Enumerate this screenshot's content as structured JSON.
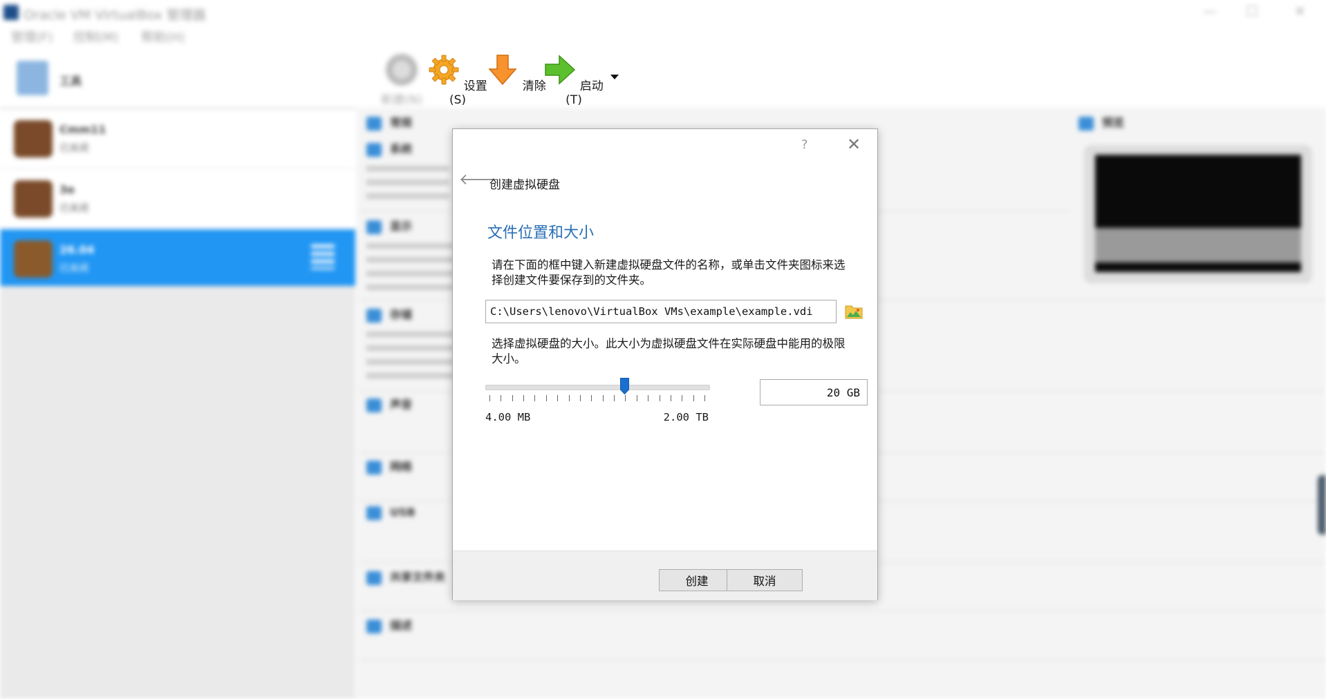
{
  "app": {
    "window_title": "Oracle VM VirtualBox 管理器",
    "menu": [
      "管理(F)",
      "控制(M)",
      "帮助(H)"
    ],
    "window_controls": [
      "—",
      "☐",
      "✕"
    ],
    "tools_label": "工具",
    "vms": [
      {
        "name": "Cmm11",
        "state": "已关闭"
      },
      {
        "name": "3e",
        "state": "已关闭"
      },
      {
        "name": "26.04",
        "state": "已关闭",
        "selected": true
      }
    ],
    "toolbar": {
      "new_label": "新建(N)",
      "settings_label": "设置(S)",
      "discard_label": "清除",
      "start_label": "启动(T)"
    },
    "details": {
      "sections": [
        "常规",
        "系统",
        "显示",
        "存储",
        "声音",
        "网络",
        "USB",
        "共享文件夹",
        "描述"
      ],
      "preview_title": "预览"
    }
  },
  "dialog": {
    "help_glyph": "?",
    "close_glyph": "✕",
    "back_glyph": "🡐",
    "title": "创建虚拟硬盘",
    "heading": "文件位置和大小",
    "location_text": "请在下面的框中键入新建虚拟硬盘文件的名称，或单击文件夹图标来选择创建文件要保存到的文件夹。",
    "file_path": "C:\\Users\\lenovo\\VirtualBox VMs\\example\\example.vdi",
    "size_text": "选择虚拟硬盘的大小。此大小为虚拟硬盘文件在实际硬盘中能用的极限大小。",
    "slider": {
      "min_label": "4.00 MB",
      "max_label": "2.00 TB",
      "value_fraction": 0.63,
      "tick_count": 20
    },
    "size_value": "20 GB",
    "create_label": "创建",
    "cancel_label": "取消"
  },
  "colors": {
    "accent": "#2196f3",
    "heading": "#2a6fb5",
    "slider_thumb": "#1a6fd0"
  }
}
